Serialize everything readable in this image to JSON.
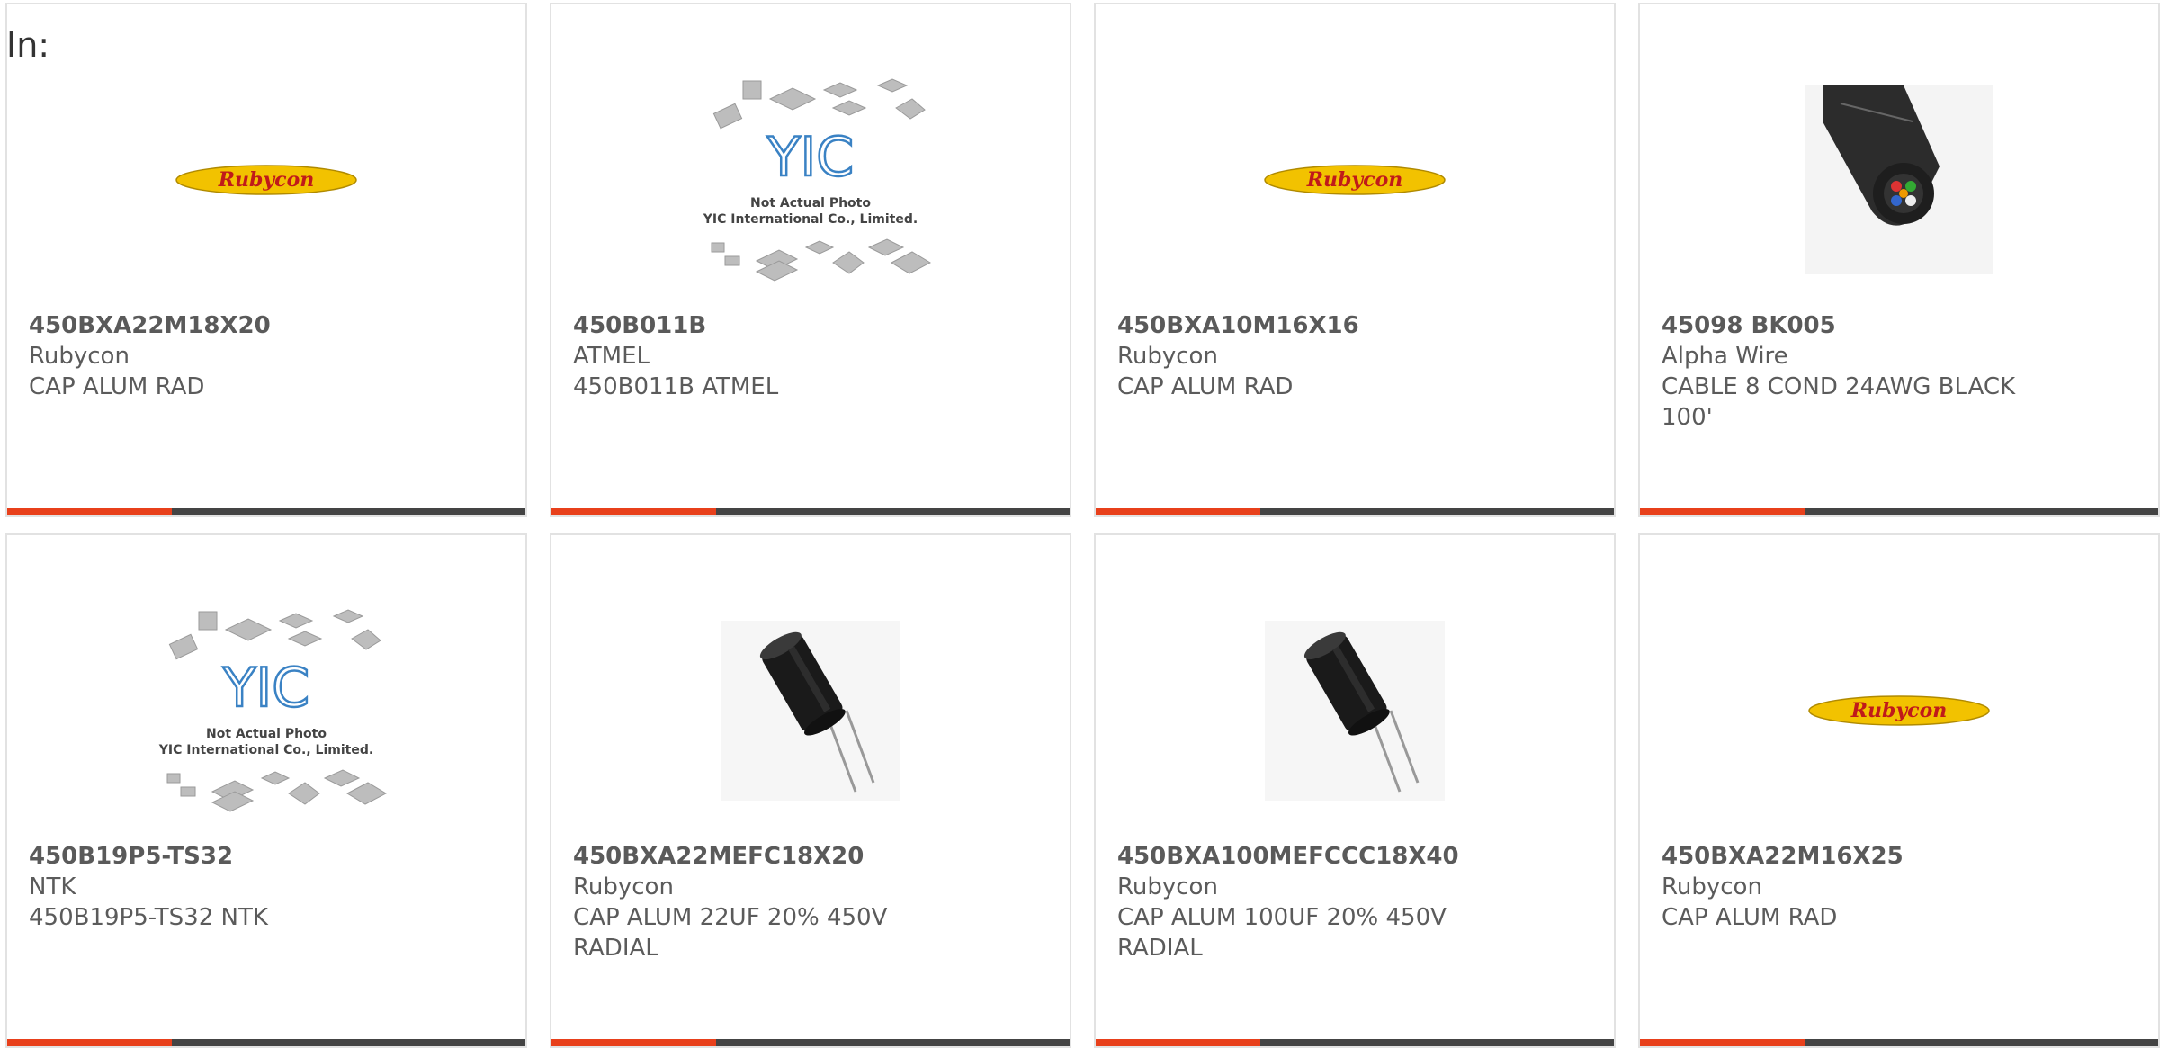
{
  "header": {
    "label": "In:"
  },
  "colors": {
    "accent": "#e8401b",
    "bar": "#444444",
    "border": "#e2e2e2"
  },
  "placeholder": {
    "line1": "Not Actual Photo",
    "line2": "YIC International Co., Limited."
  },
  "products": [
    {
      "part": "450BXA22M18X20",
      "maker": "Rubycon",
      "desc": "CAP ALUM RAD",
      "image": "rubycon-logo",
      "brand": "Rubycon"
    },
    {
      "part": "450B011B",
      "maker": "ATMEL",
      "desc": "450B011B ATMEL",
      "image": "yic-placeholder"
    },
    {
      "part": "450BXA10M16X16",
      "maker": "Rubycon",
      "desc": "CAP ALUM RAD",
      "image": "rubycon-logo",
      "brand": "Rubycon"
    },
    {
      "part": "45098 BK005",
      "maker": "Alpha Wire",
      "desc": "CABLE 8 COND 24AWG BLACK 100'",
      "image": "cable-photo"
    },
    {
      "part": "450B19P5-TS32",
      "maker": "NTK",
      "desc": "450B19P5-TS32 NTK",
      "image": "yic-placeholder"
    },
    {
      "part": "450BXA22MEFC18X20",
      "maker": "Rubycon",
      "desc": "CAP ALUM 22UF 20% 450V RADIAL",
      "image": "capacitor-photo"
    },
    {
      "part": "450BXA100MEFCCC18X40",
      "maker": "Rubycon",
      "desc": "CAP ALUM 100UF 20% 450V RADIAL",
      "image": "capacitor-photo"
    },
    {
      "part": "450BXA22M16X25",
      "maker": "Rubycon",
      "desc": "CAP ALUM RAD",
      "image": "rubycon-logo",
      "brand": "Rubycon"
    }
  ]
}
